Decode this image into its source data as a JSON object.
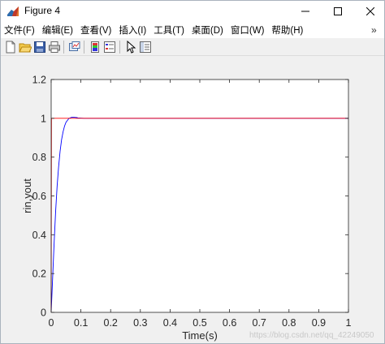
{
  "window": {
    "title": "Figure 4"
  },
  "menu": [
    "文件(F)",
    "编辑(E)",
    "查看(V)",
    "插入(I)",
    "工具(T)",
    "桌面(D)",
    "窗口(W)",
    "帮助(H)"
  ],
  "toolbar": {
    "buttons": [
      "new-figure-icon",
      "open-file-icon",
      "save-icon",
      "print-icon",
      "link-plot-icon",
      "insert-colorbar-icon",
      "insert-legend-icon",
      "edit-plot-icon",
      "property-inspector-icon"
    ]
  },
  "watermark": "https://blog.csdn.net/qq_42249050",
  "chart_data": {
    "type": "line",
    "title": "",
    "xlabel": "Time(s)",
    "ylabel": "rin,yout",
    "xlim": [
      0,
      1
    ],
    "ylim": [
      0,
      1.2
    ],
    "xticks": [
      0,
      0.1,
      0.2,
      0.3,
      0.4,
      0.5,
      0.6,
      0.7,
      0.8,
      0.9,
      1
    ],
    "xtick_labels": [
      "0",
      "0.1",
      "0.2",
      "0.3",
      "0.4",
      "0.5",
      "0.6",
      "0.7",
      "0.8",
      "0.9",
      "1"
    ],
    "yticks": [
      0,
      0.2,
      0.4,
      0.6,
      0.8,
      1,
      1.2
    ],
    "ytick_labels": [
      "0",
      "0.2",
      "0.4",
      "0.6",
      "0.8",
      "1",
      "1.2"
    ],
    "grid": false,
    "series": [
      {
        "color": "#0000ff",
        "x": [
          0,
          0.005,
          0.01,
          0.015,
          0.02,
          0.025,
          0.03,
          0.035,
          0.04,
          0.045,
          0.05,
          0.055,
          0.06,
          0.065,
          0.07,
          0.075,
          0.08,
          0.085,
          0.09,
          0.1,
          0.11,
          0.12,
          0.15,
          0.2,
          0.3,
          0.4,
          0.5,
          0.6,
          0.7,
          0.8,
          0.9,
          1.0
        ],
        "y": [
          0,
          0.18,
          0.36,
          0.52,
          0.65,
          0.75,
          0.83,
          0.89,
          0.93,
          0.96,
          0.98,
          0.99,
          1.0,
          1.003,
          1.006,
          1.006,
          1.005,
          1.004,
          1.002,
          1.001,
          1.0,
          1.0,
          1.0,
          1.0,
          1.0,
          1.0,
          1.0,
          1.0,
          1.0,
          1.0,
          1.0,
          1.0
        ]
      },
      {
        "color": "#ff0000",
        "x": [
          0,
          0.001,
          1.0
        ],
        "y": [
          0,
          1,
          1
        ]
      }
    ]
  }
}
